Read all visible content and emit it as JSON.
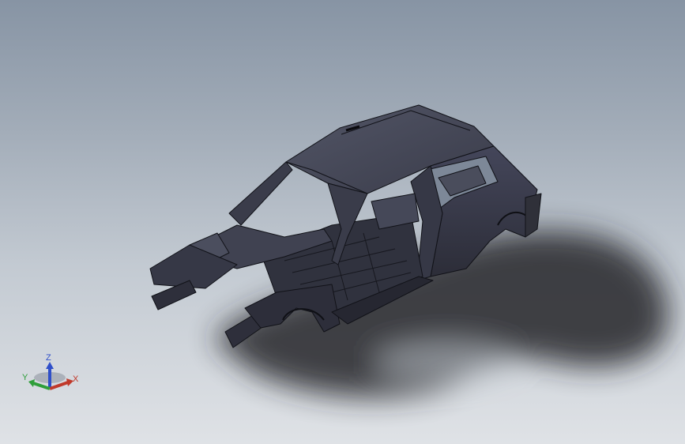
{
  "viewport": {
    "background_top": "#8794a4",
    "background_bottom": "#dfe2e6"
  },
  "model": {
    "body_color": "#3b3d4b",
    "edge_color": "#111218",
    "shadow_color": "#2a2a2e"
  },
  "triad": {
    "x_label": "X",
    "y_label": "Y",
    "z_label": "Z",
    "x_color": "#c0392b",
    "y_color": "#2e9e3a",
    "z_color": "#2f4fc9"
  }
}
